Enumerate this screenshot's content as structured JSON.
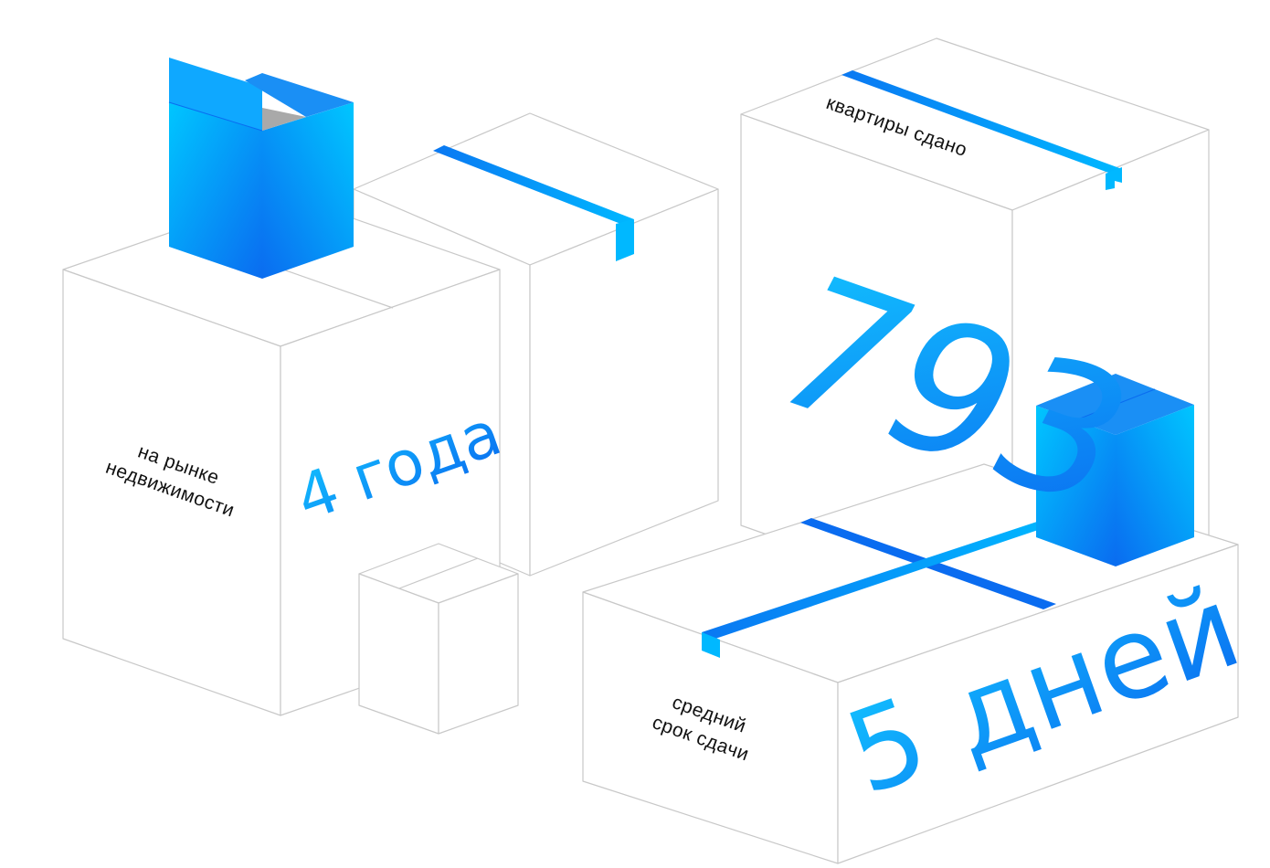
{
  "stats": [
    {
      "caption_line1": "на рынке",
      "caption_line2": "недвижимости",
      "value": "4 года"
    },
    {
      "caption": "квартиры сдано",
      "value": "793"
    },
    {
      "caption_line1": "средний",
      "caption_line2": "срок сдачи",
      "value": "5 дней"
    }
  ],
  "colors": {
    "accent_light": "#00c6ff",
    "accent_dark": "#0a6cf0",
    "box_outline": "#c8c8c8",
    "text": "#111111",
    "box_inside": "#a9a9a9"
  },
  "icons": [
    "cardboard-box-icon",
    "packing-tape-icon",
    "open-box-icon",
    "closed-box-icon"
  ]
}
